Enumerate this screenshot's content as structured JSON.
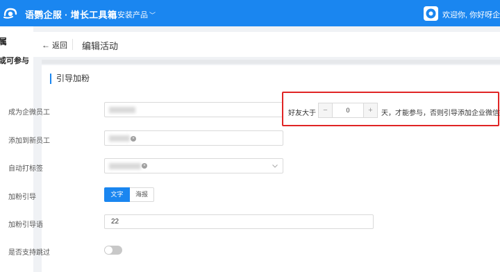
{
  "topbar": {
    "brand": "语鹦企服 · 增长工具箱",
    "installed_products": "已安装产品",
    "welcome": "欢迎你, 你好呀企鹅 -"
  },
  "sidebar": {
    "items": [
      {
        "label": "属"
      },
      {
        "label": "或可参与"
      }
    ]
  },
  "header": {
    "back_label": "返回",
    "page_title": "编辑活动"
  },
  "section": {
    "title": "引导加粉"
  },
  "form": {
    "become_employee_label": "成为企微员工",
    "friend_prefix": "好友大于",
    "friend_days_value": "0",
    "friend_suffix": "天，才能参与，否则引导添加企业微信好友",
    "add_new_employee_label": "添加到新员工",
    "auto_tag_label": "自动打标签",
    "guide_label": "加粉引导",
    "guide_options": [
      "文字",
      "海报"
    ],
    "guide_selected": "文字",
    "guide_text_label": "加粉引导语",
    "guide_text_value": "22",
    "skip_label": "是否支持跳过",
    "skip_enabled": false
  },
  "colors": {
    "primary": "#1a86f0",
    "highlight_box": "#e02424"
  },
  "icons": {
    "logo": "brand-logo-icon",
    "avatar": "user-avatar-icon",
    "back": "arrow-left-icon",
    "dropdown": "chevron-down-icon",
    "remove_tag": "close-circle-icon"
  }
}
